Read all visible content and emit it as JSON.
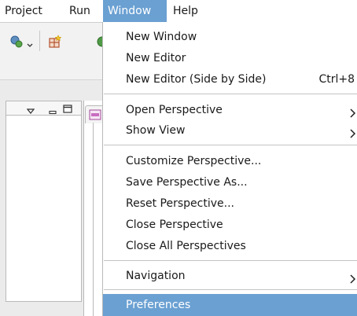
{
  "menubar": {
    "items": [
      {
        "label": "Project"
      },
      {
        "label": "Run"
      },
      {
        "label": "Window"
      },
      {
        "label": "Help"
      }
    ]
  },
  "window_menu": {
    "groups": [
      [
        {
          "label": "New Window"
        },
        {
          "label": "New Editor"
        },
        {
          "label": "New Editor (Side by Side)",
          "accelerator": "Ctrl+8"
        }
      ],
      [
        {
          "label": "Open Perspective",
          "submenu": true
        },
        {
          "label": "Show View",
          "submenu": true
        }
      ],
      [
        {
          "label": "Customize Perspective..."
        },
        {
          "label": "Save Perspective As..."
        },
        {
          "label": "Reset Perspective..."
        },
        {
          "label": "Close Perspective"
        },
        {
          "label": "Close All Perspectives"
        }
      ],
      [
        {
          "label": "Navigation",
          "submenu": true
        }
      ],
      [
        {
          "label": "Preferences",
          "highlighted": true
        }
      ]
    ]
  },
  "colors": {
    "selection": "#6aa0d2",
    "menu_background": "#ffffff",
    "separator": "#c4c4c4"
  },
  "icons": {
    "toolbar": [
      "debug-run-icon",
      "dropdown-arrow-icon",
      "new-class-icon"
    ],
    "view_header": [
      "view-menu-icon",
      "minimize-icon",
      "maximize-icon"
    ],
    "editor_tab": "xml-file-icon",
    "submenu": "chevron-right-icon"
  }
}
